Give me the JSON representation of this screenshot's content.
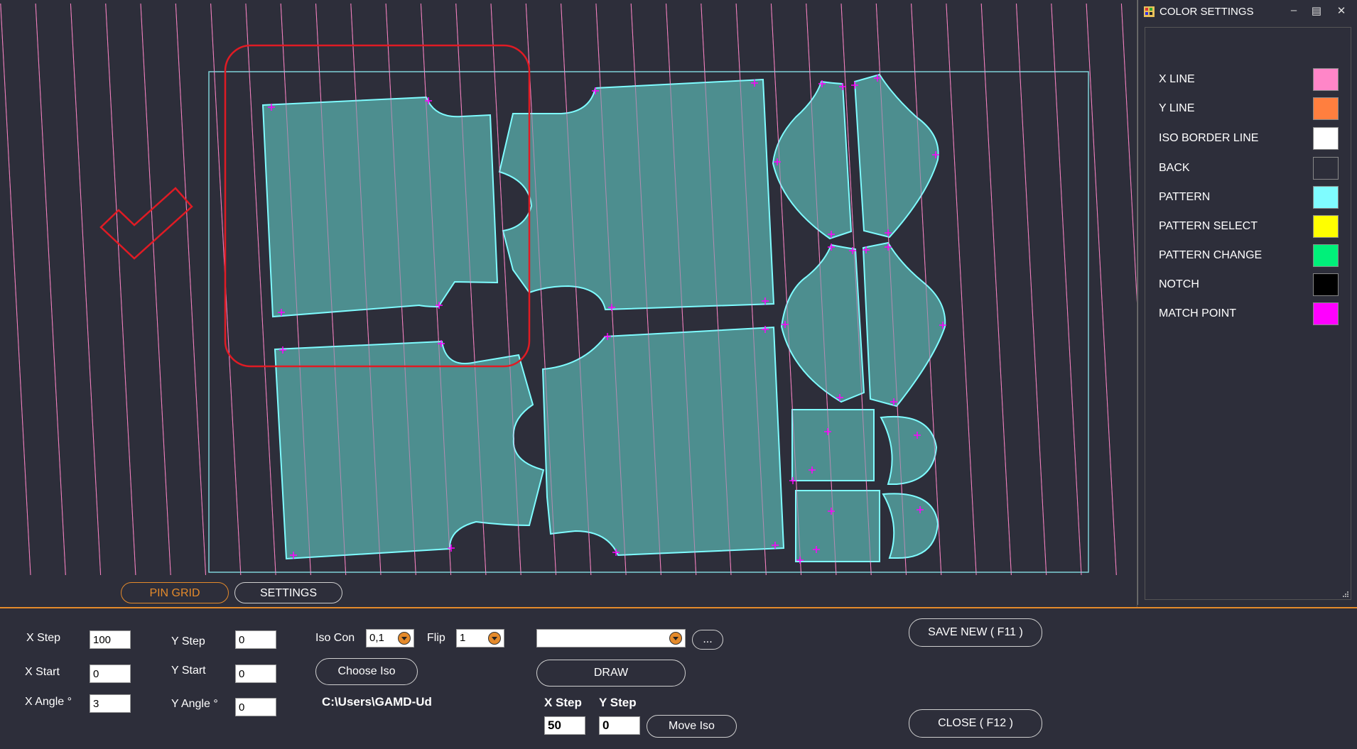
{
  "tabs": {
    "pin_grid": "PIN GRID",
    "settings": "SETTINGS"
  },
  "color_panel": {
    "title": "COLOR SETTINGS",
    "items": [
      {
        "label": "X LINE",
        "color": "#ff86c8"
      },
      {
        "label": "Y LINE",
        "color": "#ff7f3f"
      },
      {
        "label": "ISO BORDER LINE",
        "color": "#ffffff"
      },
      {
        "label": "BACK",
        "color": "#2d2e3a"
      },
      {
        "label": "PATTERN",
        "color": "#7ffcff"
      },
      {
        "label": "PATTERN SELECT",
        "color": "#ffff00"
      },
      {
        "label": "PATTERN CHANGE",
        "color": "#00f07a"
      },
      {
        "label": "NOTCH",
        "color": "#000000"
      },
      {
        "label": "MATCH POINT",
        "color": "#ff00ff"
      }
    ]
  },
  "colors": {
    "accent": "#e48a2b",
    "pattern_fill": "#4f9393",
    "pattern_border": "#7ffcff",
    "iso_border": "#7fd0d8",
    "x_line": "#ff86c8",
    "selection": "#e01b24"
  },
  "form": {
    "x_step_label": "X Step",
    "x_step_value": "100",
    "x_start_label": "X Start",
    "x_start_value": "0",
    "x_angle_label": "X Angle °",
    "x_angle_value": "3",
    "y_step_label": "Y Step",
    "y_step_value": "0",
    "y_start_label": "Y Start",
    "y_start_value": "0",
    "y_angle_label": "Y Angle °",
    "y_angle_value": "0",
    "iso_con_label": "Iso Con",
    "iso_con_value": "0,1",
    "flip_label": "Flip",
    "flip_value": "1",
    "choose_iso": "Choose Iso",
    "path": "C:\\Users\\GAMD-Ud",
    "file_select_value": "",
    "browse": "...",
    "draw": "DRAW",
    "move_x_label": "X Step",
    "move_x_value": "50",
    "move_y_label": "Y Step",
    "move_y_value": "0",
    "move_iso": "Move Iso",
    "save_new": "SAVE NEW ( F11 )",
    "close": "CLOSE ( F12 )"
  }
}
